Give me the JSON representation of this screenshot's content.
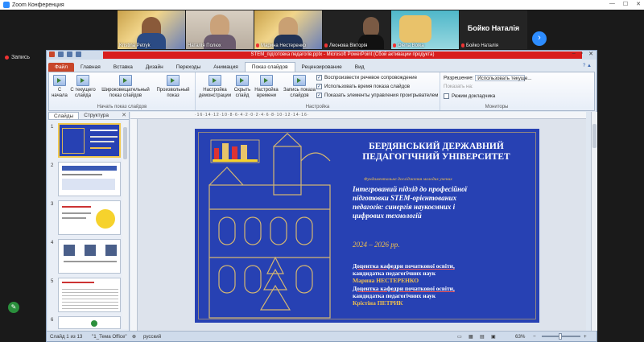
{
  "zoom": {
    "window_title": "Zoom Конференция",
    "record_label": "Запись",
    "participants": [
      {
        "name": "Kristina Petryk",
        "muted": false
      },
      {
        "name": "Наталія Полюх",
        "muted": false
      },
      {
        "name": "Марина Нестеренко",
        "muted": true
      },
      {
        "name": "Леонова Вікторія",
        "muted": true
      },
      {
        "name": "Olena Boika",
        "muted": true
      },
      {
        "name": "Бойко Наталія",
        "muted": true,
        "display_big": "Бойко Наталія"
      }
    ],
    "next_icon": "chevron-right-icon"
  },
  "ppt": {
    "banner": "STEM_підготовка педагогів.pptx - Microsoft PowerPoint (Сбой активации продукта)",
    "tabs": [
      "Файл",
      "Главная",
      "Вставка",
      "Дизайн",
      "Переходы",
      "Анимация",
      "Показ слайдов",
      "Рецензирование",
      "Вид"
    ],
    "active_tab": "Показ слайдов",
    "ribbon": {
      "start_group": {
        "label": "Начать показ слайдов",
        "btn_start": "С начала",
        "btn_current": "С текущего слайда",
        "btn_broadcast": "Широковещательный показ слайдов",
        "btn_custom": "Произвольный показ"
      },
      "setup_group": {
        "label": "Настройка",
        "btn_setup": "Настройка демонстрации",
        "btn_hide": "Скрыть слайд",
        "btn_timing": "Настройка времени",
        "btn_record": "Запись показа слайдов",
        "chk_narration": "Воспроизвести речевое сопровождение",
        "chk_timings": "Использовать время показа слайдов",
        "chk_controls": "Показать элементы управления проигрывателем"
      },
      "monitors_group": {
        "label": "Мониторы",
        "resolution_label": "Разрешение:",
        "resolution_value": "Использовать текуще...",
        "show_on_label": "Показать на:",
        "presenter_view": "Режим докладчика"
      }
    },
    "panel": {
      "tab_slides": "Слайды",
      "tab_outline": "Структура",
      "slide_numbers": [
        "1",
        "2",
        "3",
        "4",
        "5",
        "6"
      ]
    },
    "ruler_text": "·16·14·12·10·8·6·4·2·0·2·4·6·8·10·12·14·16·",
    "slide": {
      "title_line1": "БЕРДЯНСЬКИЙ ДЕРЖАВНИЙ",
      "title_line2": "ПЕДАГОГІЧНИЙ УНІВЕРСИТЕТ",
      "subtitle": "Фундаментальне дослідження молодих учених",
      "body_line1": "Інтегрований підхід до професійної",
      "body_line2": "підготовки STEM-орієнтованих",
      "body_line3": "педагогів: синергія наукоємних і",
      "body_line4": "цифрових технологій",
      "years": "2024 – 2026 рр.",
      "author1_role1": "Доцентка кафедри початкової освіти,",
      "author1_role2": "кандидатка педагогічних наук",
      "author1_name": "Марина НЕСТЕРЕНКО",
      "author2_role1": "Доцентка кафедри початкової освіти,",
      "author2_role2": "кандидатка педагогічних наук",
      "author2_name": "Крістіна ПЕТРИК"
    },
    "status": {
      "slide_info": "Слайд 1 из 13",
      "theme": "\"1_Тема Office\"",
      "language": "русский",
      "zoom": "63%"
    }
  }
}
